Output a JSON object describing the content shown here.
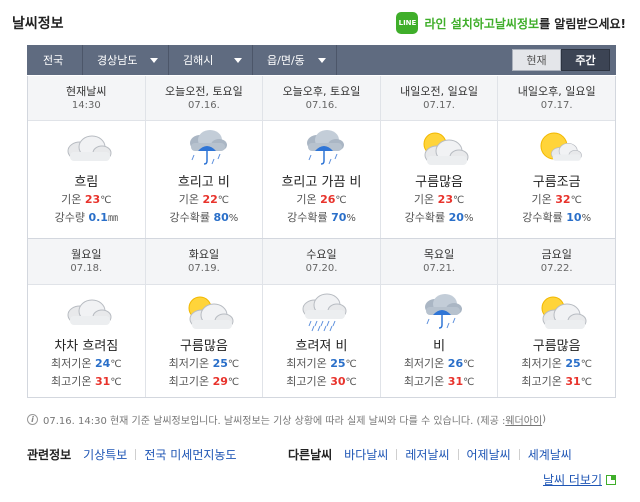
{
  "header": {
    "title": "날씨정보",
    "line_promo": {
      "icon_text": "LINE",
      "part1": "라인 설치하고 ",
      "part2": "날씨정보",
      "part3": "를 알림받으세요!"
    }
  },
  "nav": {
    "crumbs": [
      "전국",
      "경상남도",
      "김해시",
      "읍/면/동"
    ],
    "toggle": {
      "current": "현재",
      "weekly": "주간",
      "active": "주간"
    }
  },
  "row1": [
    {
      "h1": "현재날씨",
      "h2": "14:30",
      "icon": "cloudy-icon",
      "cond": "흐림",
      "l1_label": "기온 ",
      "l1_val": "23",
      "l1_unit": "℃",
      "l2_label": "강수량 ",
      "l2_val": "0.1",
      "l2_unit": "㎜"
    },
    {
      "h1": "오늘오전, 토요일",
      "h2": "07.16.",
      "icon": "rain-icon",
      "cond": "흐리고 비",
      "l1_label": "기온 ",
      "l1_val": "22",
      "l1_unit": "℃",
      "l2_label": "강수확률 ",
      "l2_val": "80",
      "l2_unit": "%"
    },
    {
      "h1": "오늘오후, 토요일",
      "h2": "07.16.",
      "icon": "rain-icon",
      "cond": "흐리고 가끔 비",
      "l1_label": "기온 ",
      "l1_val": "26",
      "l1_unit": "℃",
      "l2_label": "강수확률 ",
      "l2_val": "70",
      "l2_unit": "%"
    },
    {
      "h1": "내일오전, 일요일",
      "h2": "07.17.",
      "icon": "sun-cloud-icon",
      "cond": "구름많음",
      "l1_label": "기온 ",
      "l1_val": "23",
      "l1_unit": "℃",
      "l2_label": "강수확률 ",
      "l2_val": "20",
      "l2_unit": "%"
    },
    {
      "h1": "내일오후, 일요일",
      "h2": "07.17.",
      "icon": "sun-small-cloud-icon",
      "cond": "구름조금",
      "l1_label": "기온 ",
      "l1_val": "32",
      "l1_unit": "℃",
      "l2_label": "강수확률 ",
      "l2_val": "10",
      "l2_unit": "%"
    }
  ],
  "row2": [
    {
      "h1": "월요일",
      "h2": "07.18.",
      "icon": "cloudy-icon",
      "cond": "차차 흐려짐",
      "min": "24",
      "max": "31"
    },
    {
      "h1": "화요일",
      "h2": "07.19.",
      "icon": "sun-cloud-icon",
      "cond": "구름많음",
      "min": "25",
      "max": "29"
    },
    {
      "h1": "수요일",
      "h2": "07.20.",
      "icon": "shower-icon",
      "cond": "흐려져 비",
      "min": "25",
      "max": "30"
    },
    {
      "h1": "목요일",
      "h2": "07.21.",
      "icon": "rain-icon",
      "cond": "비",
      "min": "26",
      "max": "31"
    },
    {
      "h1": "금요일",
      "h2": "07.22.",
      "icon": "sun-cloud-icon",
      "cond": "구름많음",
      "min": "25",
      "max": "31"
    }
  ],
  "labels": {
    "min": "최저기온 ",
    "max": "최고기온 ",
    "unit": "℃"
  },
  "notice": {
    "text": "07.16. 14:30 현재 기준 날씨정보입니다. 날씨정보는 기상 상황에 따라 실제 날씨와 다를 수 있습니다. (제공 : ",
    "link": "웨더아이",
    "close": ")"
  },
  "related": {
    "heading": "관련정보",
    "items": [
      "기상특보",
      "전국 미세먼지농도"
    ]
  },
  "other": {
    "heading": "다른날씨",
    "items": [
      "바다날씨",
      "레저날씨",
      "어제날씨",
      "세계날씨"
    ]
  },
  "more": "날씨 더보기",
  "colors": {
    "nav_bg": "#5f6b80",
    "red": "#e8332c",
    "blue": "#2a6fc9",
    "line_green": "#3fae2a"
  }
}
